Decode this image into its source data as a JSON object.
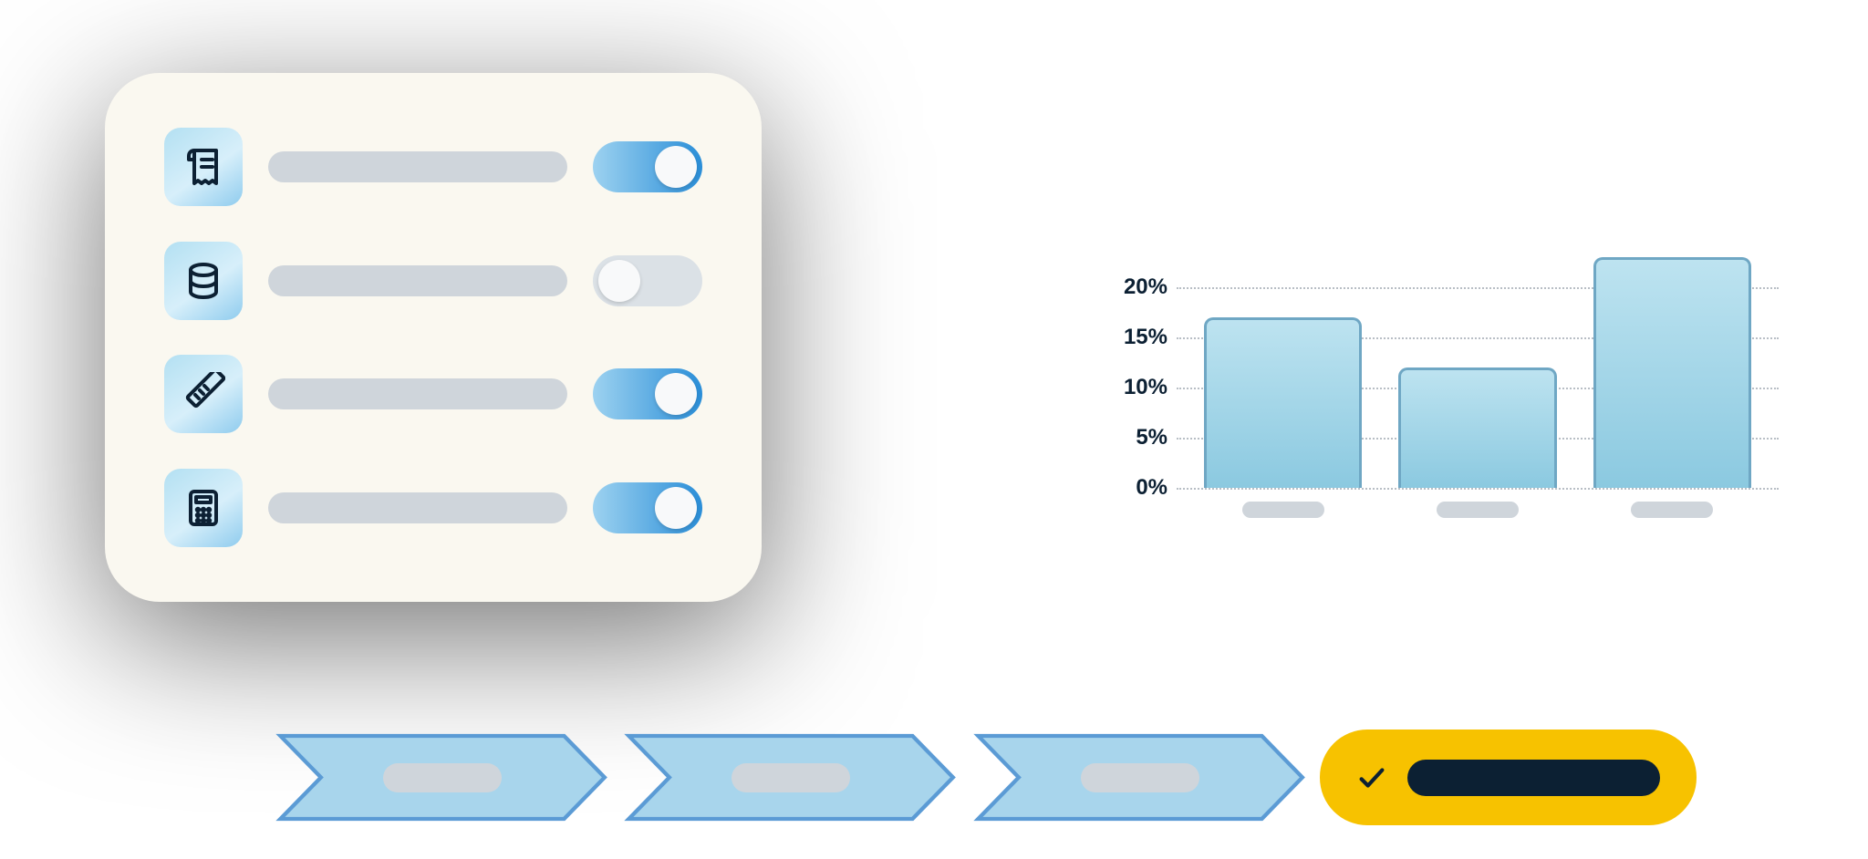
{
  "settings": {
    "rows": [
      {
        "icon": "receipt",
        "toggled": true
      },
      {
        "icon": "database",
        "toggled": false
      },
      {
        "icon": "ruler",
        "toggled": true
      },
      {
        "icon": "calculator",
        "toggled": true
      }
    ]
  },
  "chart_data": {
    "type": "bar",
    "categories": [
      "",
      "",
      ""
    ],
    "values": [
      17,
      12,
      23
    ],
    "y_ticks": [
      0,
      5,
      10,
      15,
      20
    ],
    "y_tick_labels": [
      "0%",
      "5%",
      "10%",
      "15%",
      "20%"
    ],
    "ymax": 25,
    "title": "",
    "xlabel": "",
    "ylabel": ""
  },
  "process": {
    "steps": [
      {
        "kind": "arrow"
      },
      {
        "kind": "arrow"
      },
      {
        "kind": "arrow"
      },
      {
        "kind": "final"
      }
    ]
  },
  "colors": {
    "accent_blue": "#2a8ed8",
    "light_blue": "#a8d5ec",
    "yellow": "#f7c200",
    "dark": "#0c2033"
  }
}
